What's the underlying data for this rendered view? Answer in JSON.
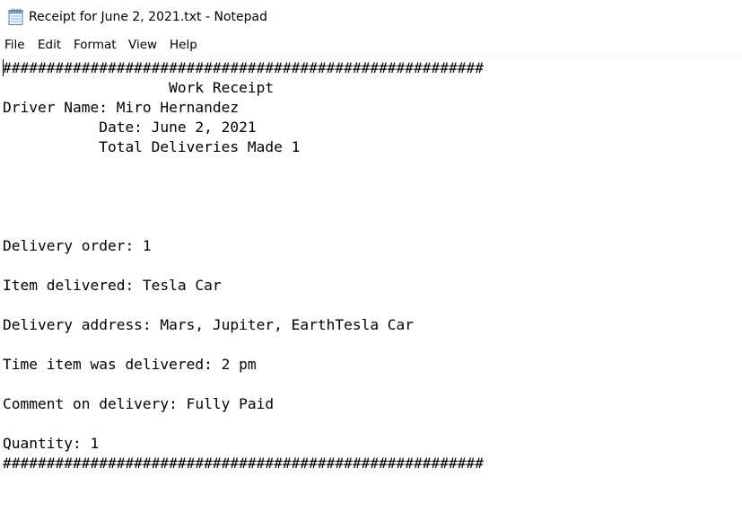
{
  "window": {
    "title": "Receipt for June 2, 2021.txt - Notepad",
    "icon": "notepad-icon"
  },
  "menu": {
    "file": "File",
    "edit": "Edit",
    "format": "Format",
    "view": "View",
    "help": "Help"
  },
  "document": {
    "text": "#######################################################\n                   Work Receipt\nDriver Name: Miro Hernandez\n           Date: June 2, 2021\n           Total Deliveries Made 1\n\n\n\n\nDelivery order: 1\n\nItem delivered: Tesla Car\n\nDelivery address: Mars, Jupiter, EarthTesla Car\n\nTime item was delivered: 2 pm\n\nComment on delivery: Fully Paid\n\nQuantity: 1\n#######################################################"
  }
}
